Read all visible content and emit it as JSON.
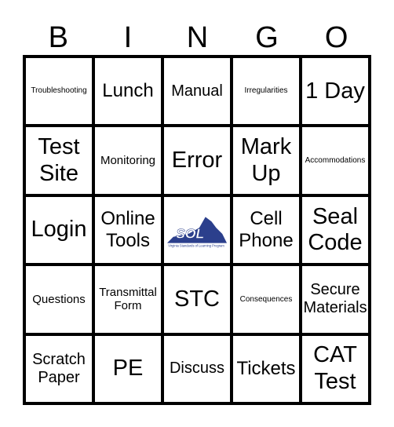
{
  "header": [
    "B",
    "I",
    "N",
    "G",
    "O"
  ],
  "cells": [
    [
      "Troubleshooting",
      "Lunch",
      "Manual",
      "Irregularities",
      "1 Day"
    ],
    [
      "Test Site",
      "Monitoring",
      "Error",
      "Mark Up",
      "Accommodations"
    ],
    [
      "Login",
      "Online Tools",
      "FREE_LOGO",
      "Cell Phone",
      "Seal Code"
    ],
    [
      "Questions",
      "Transmittal Form",
      "STC",
      "Consequences",
      "Secure Materials"
    ],
    [
      "Scratch Paper",
      "PE",
      "Discuss",
      "Tickets",
      "CAT Test"
    ]
  ],
  "center_logo": {
    "text": "SOL",
    "subtitle": "Virginia Standards of Learning Program",
    "color": "#2b3f8c"
  }
}
